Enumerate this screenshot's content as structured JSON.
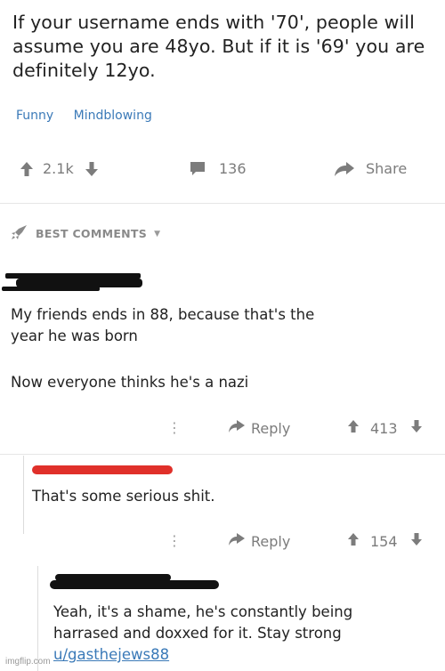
{
  "post": {
    "title": "If your username ends with '70', people will assume you are 48yo. But if it is '69' you are definitely 12yo.",
    "tags": [
      "Funny",
      "Mindblowing"
    ],
    "upvotes": "2.1k",
    "comments_count": "136",
    "share_label": "Share"
  },
  "sort": {
    "label": "BEST COMMENTS"
  },
  "comments": [
    {
      "lines": [
        "My friends ends in 88, because that's the",
        "year he was born"
      ],
      "second_paragraph": "Now everyone thinks he's a nazi",
      "reply_label": "Reply",
      "score": "413"
    },
    {
      "lines": [
        "That's some serious shit."
      ],
      "reply_label": "Reply",
      "score": "154"
    },
    {
      "lines": [
        "Yeah, it's a shame, he's constantly being",
        "harrased and doxxed for it.  Stay strong"
      ],
      "link": "u/gasthejews88"
    }
  ],
  "watermark": "imgflip.com",
  "colors": {
    "link": "#3b7ab8",
    "meta": "#7c7c7c",
    "redact_red": "#e0302a"
  }
}
